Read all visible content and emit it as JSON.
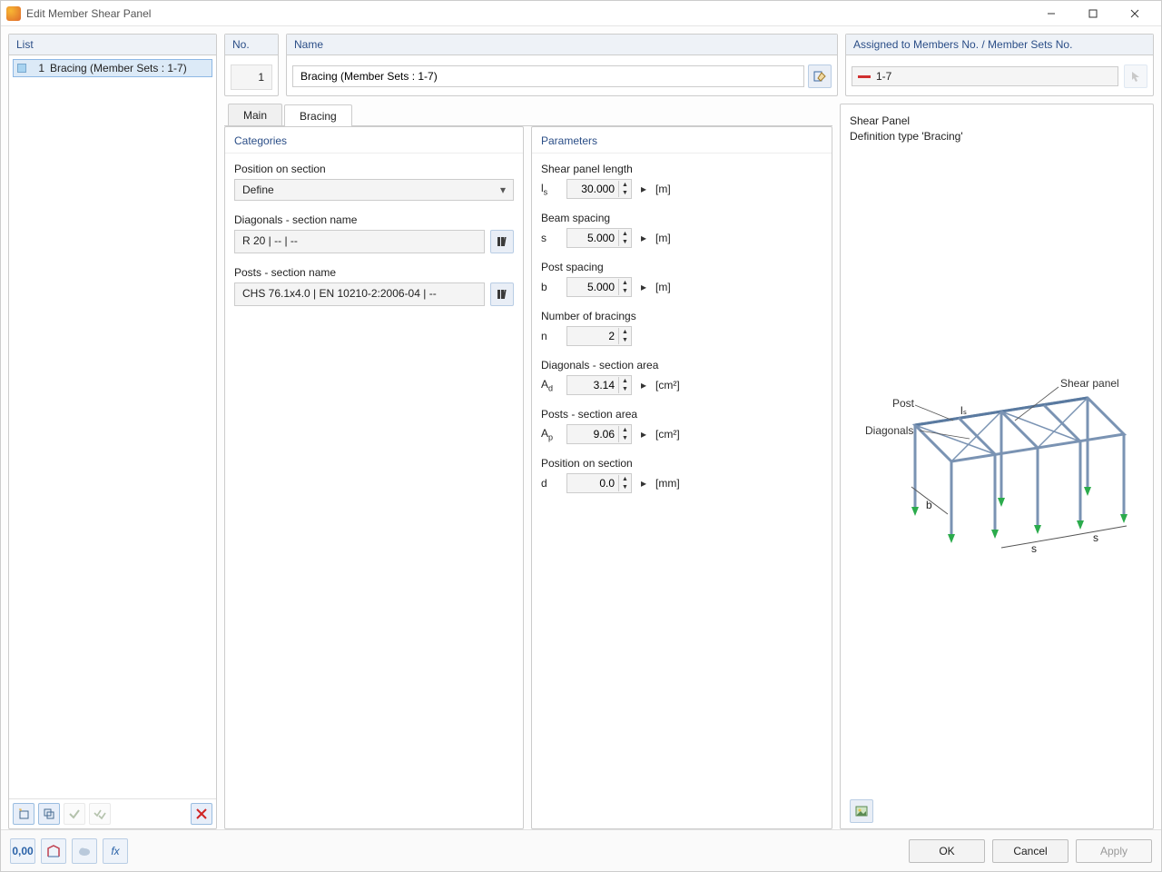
{
  "window": {
    "title": "Edit Member Shear Panel"
  },
  "left": {
    "header": "List",
    "item": {
      "id": "1",
      "label": "Bracing (Member Sets : 1-7)"
    }
  },
  "top": {
    "no_caption": "No.",
    "no_value": "1",
    "name_caption": "Name",
    "name_value": "Bracing (Member Sets : 1-7)",
    "assigned_caption": "Assigned to Members No. / Member Sets No.",
    "assigned_value": "1-7"
  },
  "tabs": {
    "main": "Main",
    "bracing": "Bracing"
  },
  "categories": {
    "header": "Categories",
    "position_label": "Position on section",
    "position_value": "Define",
    "diag_label": "Diagonals - section name",
    "diag_value": "R 20 | -- | --",
    "posts_label": "Posts - section name",
    "posts_value": "CHS 76.1x4.0 | EN 10210-2:2006-04 | --"
  },
  "parameters": {
    "header": "Parameters",
    "rows": [
      {
        "label": "Shear panel length",
        "sym": "l",
        "sub": "s",
        "val": "30.000",
        "unit": "[m]",
        "stepper": true,
        "tri": true
      },
      {
        "label": "Beam spacing",
        "sym": "s",
        "sub": "",
        "val": "5.000",
        "unit": "[m]",
        "stepper": true,
        "tri": true
      },
      {
        "label": "Post spacing",
        "sym": "b",
        "sub": "",
        "val": "5.000",
        "unit": "[m]",
        "stepper": true,
        "tri": true
      },
      {
        "label": "Number of bracings",
        "sym": "n",
        "sub": "",
        "val": "2",
        "unit": "",
        "stepper": true,
        "tri": false
      },
      {
        "label": "Diagonals - section area",
        "sym": "A",
        "sub": "d",
        "val": "3.14",
        "unit": "[cm²]",
        "stepper": true,
        "tri": true
      },
      {
        "label": "Posts - section area",
        "sym": "A",
        "sub": "p",
        "val": "9.06",
        "unit": "[cm²]",
        "stepper": true,
        "tri": true
      },
      {
        "label": "Position on section",
        "sym": "d",
        "sub": "",
        "val": "0.0",
        "unit": "[mm]",
        "stepper": true,
        "tri": true
      }
    ]
  },
  "info": {
    "header": "Shear Panel",
    "subtitle": "Definition type 'Bracing'",
    "labels": {
      "shear": "Shear panel",
      "post": "Post",
      "diag": "Diagonals",
      "ls": "lₛ",
      "b": "b",
      "s": "s"
    }
  },
  "footer": {
    "ok": "OK",
    "cancel": "Cancel",
    "apply": "Apply"
  }
}
